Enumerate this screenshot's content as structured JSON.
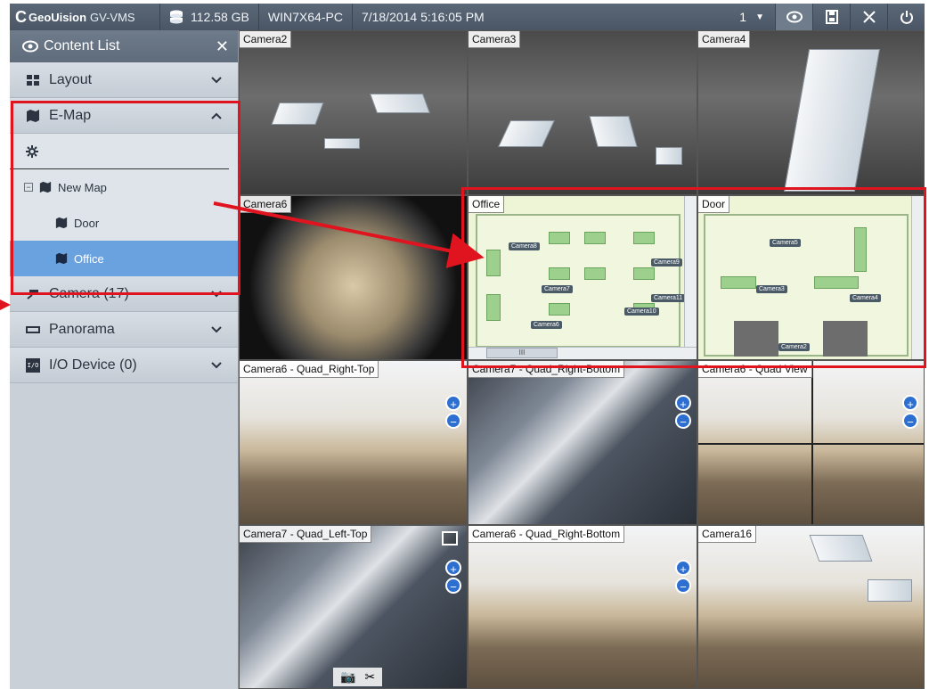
{
  "topbar": {
    "brand_mark": "C",
    "brand": "GeoUision",
    "product": "GV-VMS",
    "disk": "112.58 GB",
    "host": "WIN7X64-PC",
    "datetime": "7/18/2014 5:16:05 PM",
    "page": "1",
    "buttons": [
      "eye-icon",
      "save-icon",
      "tools-icon",
      "power-icon"
    ]
  },
  "sidebar": {
    "title": "Content List",
    "close": "✕",
    "sections": [
      {
        "label": "Layout",
        "icon": "layout-icon"
      },
      {
        "label": "E-Map",
        "icon": "map-icon",
        "expanded": true
      },
      {
        "label": "Camera (17)",
        "icon": "camera-icon"
      },
      {
        "label": "Panorama",
        "icon": "panorama-icon"
      },
      {
        "label": "I/O Device (0)",
        "icon": "io-icon"
      }
    ],
    "emap_tree": {
      "root": "New Map",
      "children": [
        "Door",
        "Office"
      ],
      "selected": "Office"
    },
    "io_badge": "I/O"
  },
  "tiles": {
    "camera2": "Camera2",
    "camera3": "Camera3",
    "camera4": "Camera4",
    "camera6": "Camera6",
    "office": "Office",
    "door": "Door",
    "quad_right_top": "Camera6 - Quad_Right-Top",
    "quad_right_bottom": "Camera7 - Quad_Right-Bottom",
    "quad_view": "Camera6 - Quad View",
    "quad_left_top": "Camera7 - Quad_Left-Top",
    "quad_right_bottom2": "Camera6 - Quad_Right-Bottom",
    "camera16": "Camera16"
  },
  "map_labels": {
    "office": [
      "Camera8",
      "Camera7",
      "Camera9",
      "Camera10",
      "Camera6",
      "Camera11"
    ],
    "door": [
      "Camera5",
      "Camera3",
      "Camera4",
      "Camera2"
    ]
  },
  "scroll_h_thumb": "III",
  "colors": {
    "highlight": "#e0141e",
    "selected": "#6aa2e0",
    "topbar": "#4f5b6b"
  }
}
